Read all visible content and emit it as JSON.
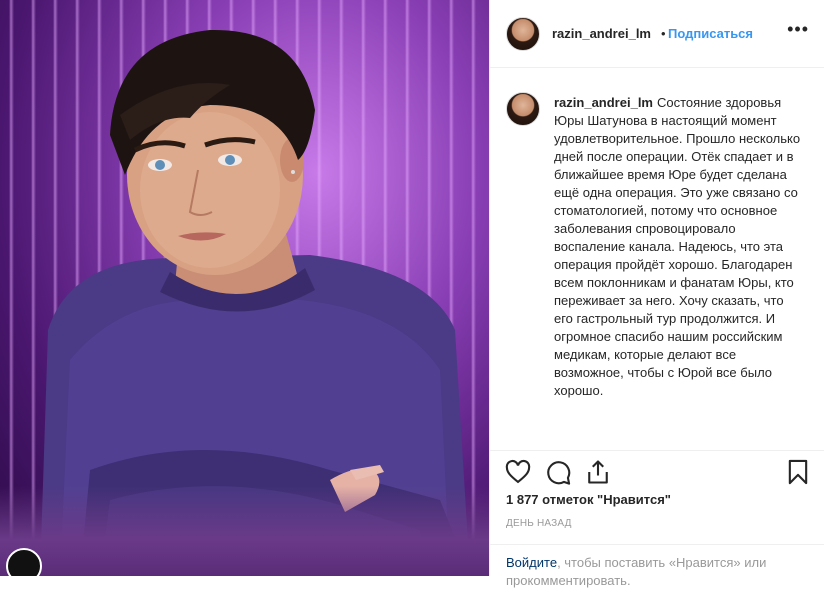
{
  "post": {
    "author": "razin_andrei_lm",
    "dot": "•",
    "follow_label": "Подписаться",
    "more_label": "•••",
    "caption_text": "Состояние здоровья Юры Шатунова в настоящий момент удовлетворительное. Прошло несколько дней после операции. Отёк спадает и в ближайшее время Юре будет сделана ещё одна операция. Это уже связано со стоматологией, потому что основное заболевания спровоцировало воспаление канала. Надеюсь, что эта операция пройдёт хорошо. Благодарен всем поклонникам и фанатам Юры, кто переживает за него. Хочу сказать, что его гастрольный тур продолжится. И огромное спасибо нашим российским медикам, которые делают все возможное, чтобы с Юрой все было хорошо.",
    "likes": "1 877 отметок \"Нравится\"",
    "time": "день назад"
  },
  "footer": {
    "login_link": "Войдите",
    "login_text": ", чтобы поставить «Нравится» или прокомментировать."
  },
  "icons": {
    "like": "heart-icon",
    "comment": "comment-icon",
    "share": "share-icon",
    "save": "bookmark-icon",
    "more": "more-icon"
  },
  "colors": {
    "accent": "#3897f0",
    "link": "#003569",
    "text": "#262626",
    "muted": "#999999",
    "border": "#efefef"
  }
}
